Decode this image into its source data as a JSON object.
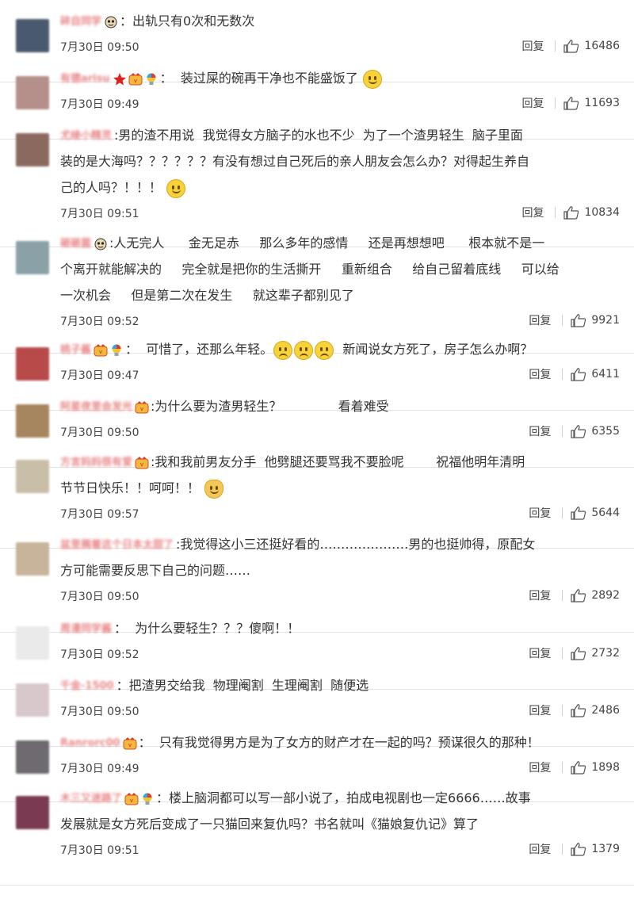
{
  "reply_label": "回复",
  "comments": [
    {
      "username": "碎自同学",
      "avatar_color": "#4a5a6e",
      "badges": [
        "eye"
      ],
      "lines": [
        [
          {
            "t": "：出轨只有0次和无数次"
          }
        ]
      ],
      "time": "7月30日 09:50",
      "likes": "16486"
    },
    {
      "username": "有德arisu",
      "avatar_color": "#b58f8a",
      "badges": [
        "star",
        "vip",
        "bulb"
      ],
      "lines": [
        [
          {
            "t": "：  装过屎的碗再干净也不能盛饭了 "
          },
          {
            "e": "smile"
          }
        ]
      ],
      "time": "7月30日 09:49",
      "likes": "11693"
    },
    {
      "username": "尤绫小精灵",
      "avatar_color": "#8a6a5e",
      "badges": [],
      "lines": [
        [
          {
            "t": ":男的渣不用说  我觉得女方脑子的水也不少  为了一个渣男轻生  脑子里面"
          }
        ],
        [
          {
            "t": "装的是大海吗？？？？？？有没有想过自己死后的亲人朋友会怎么办？对得起生养自"
          }
        ],
        [
          {
            "t": "己的人吗？！！！ "
          },
          {
            "e": "smile"
          }
        ]
      ],
      "time": "7月30日 09:51",
      "likes": "10834"
    },
    {
      "username": "砸砸菌",
      "avatar_color": "#8aa1a8",
      "badges": [
        "eye"
      ],
      "lines": [
        [
          {
            "t": ":人无完人      金无足赤     那么多年的感情     还是再想想吧      根本就不是一"
          }
        ],
        [
          {
            "t": "个离开就能解决的     完全就是把你的生活撕开     重新组合     给自己留着底线     可以给"
          }
        ],
        [
          {
            "t": "一次机会     但是第二次在发生     就这辈子都别见了"
          }
        ]
      ],
      "time": "7月30日 09:52",
      "likes": "9921"
    },
    {
      "username": "桃子酱",
      "avatar_color": "#b84a4a",
      "badges": [
        "vip",
        "bulb"
      ],
      "lines": [
        [
          {
            "t": "：  可惜了，还那么年轻。"
          },
          {
            "e": "sad"
          },
          {
            "e": "sad"
          },
          {
            "e": "sad"
          },
          {
            "t": "  新闻说女方死了，房子怎么办啊？"
          }
        ]
      ],
      "time": "7月30日 09:47",
      "likes": "6411"
    },
    {
      "username": "阿星夜里会发光",
      "avatar_color": "#a6865e",
      "badges": [
        "vip"
      ],
      "lines": [
        [
          {
            "t": ":为什么要为渣男轻生？              看着难受"
          }
        ]
      ],
      "time": "7月30日 09:50",
      "likes": "6355"
    },
    {
      "username": "方言妈妈很有爱",
      "avatar_color": "#c9bfa8",
      "badges": [
        "vip"
      ],
      "lines": [
        [
          {
            "t": ":我和我前男友分手  他劈腿还要骂我不要脸呢        祝福他明年清明"
          }
        ],
        [
          {
            "t": "节节日快乐！！呵呵！！ "
          },
          {
            "e": "cat"
          }
        ]
      ],
      "time": "7月30日 09:57",
      "likes": "5644"
    },
    {
      "username": "盆里搁着这个日本太甜了",
      "avatar_color": "#c7b49a",
      "badges": [],
      "lines": [
        [
          {
            "t": ":我觉得这小三还挺好看的…………………男的也挺帅得，原配女"
          }
        ],
        [
          {
            "t": "方可能需要反思下自己的问题……"
          }
        ]
      ],
      "time": "7月30日 09:50",
      "likes": "2892"
    },
    {
      "username": "周漫同学酱",
      "avatar_color": "#eaeaea",
      "badges": [],
      "lines": [
        [
          {
            "t": "：  为什么要轻生？？？傻啊！！"
          }
        ]
      ],
      "time": "7月30日 09:52",
      "likes": "2732"
    },
    {
      "username": "千金-1500",
      "avatar_color": "#d8c8cc",
      "badges": [],
      "lines": [
        [
          {
            "t": "：把渣男交给我  物理阉割  生理阉割  随便选"
          }
        ]
      ],
      "time": "7月30日 09:50",
      "likes": "2486"
    },
    {
      "username": "Ranrorc00",
      "avatar_color": "#6e6a70",
      "badges": [
        "vip"
      ],
      "lines": [
        [
          {
            "t": "：  只有我觉得男方是为了女方的财产才在一起的吗？预谋很久的那种！"
          }
        ]
      ],
      "time": "7月30日 09:49",
      "likes": "1898"
    },
    {
      "username": "木三又迷路了",
      "avatar_color": "#7a3a52",
      "badges": [
        "vip",
        "bulb"
      ],
      "lines": [
        [
          {
            "t": "：楼上脑洞都可以写一部小说了，拍成电视剧也一定6666……故事"
          }
        ],
        [
          {
            "t": "发展就是女方死后变成了一只猫回来复仇吗？书名就叫《猫娘复仇记》算了"
          }
        ]
      ],
      "time": "7月30日 09:51",
      "likes": "1379"
    }
  ]
}
